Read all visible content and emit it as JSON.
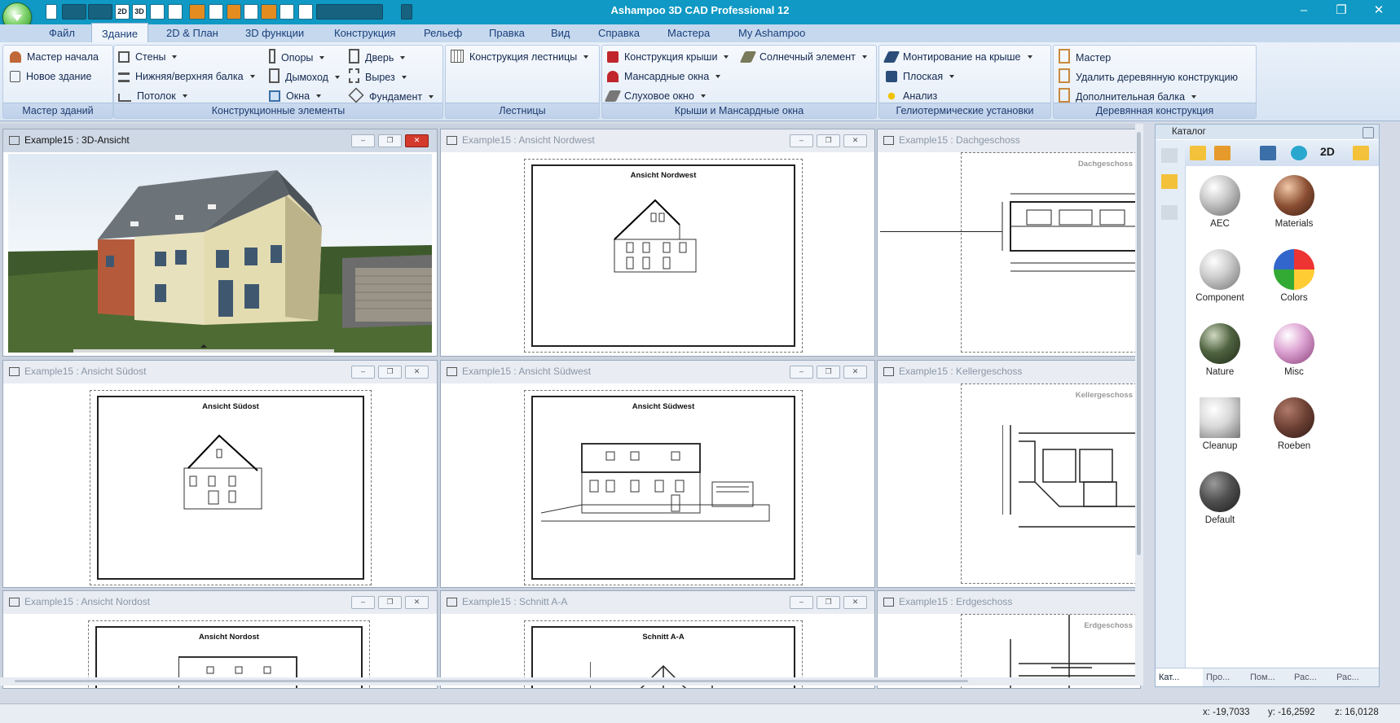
{
  "app": {
    "title": "Ashampoo 3D CAD Professional 12",
    "window_controls": [
      "minimize-icon",
      "maximize-icon",
      "close-icon"
    ],
    "quick_access": [
      "2D",
      "3D"
    ]
  },
  "ribbon": {
    "tabs": [
      "Файл",
      "Здание",
      "2D & План",
      "3D функции",
      "Конструкция",
      "Рельеф",
      "Правка",
      "Вид",
      "Справка",
      "Мастера",
      "My Ashampoo"
    ],
    "active_tab": "Здание",
    "groups": {
      "wizard": {
        "label": "Мастер зданий",
        "items": [
          "Мастер начала",
          "Новое здание"
        ]
      },
      "construction": {
        "label": "Конструкционные элементы",
        "items": [
          "Стены",
          "Нижняя/верхняя балка",
          "Потолок",
          "Опоры",
          "Дымоход",
          "Окна",
          "Дверь",
          "Вырез",
          "Фундамент"
        ]
      },
      "stairs": {
        "label": "Лестницы",
        "items": [
          "Конструкция лестницы"
        ]
      },
      "roofs": {
        "label": "Крыши и Мансардные окна",
        "items": [
          "Конструкция крыши",
          "Мансардные окна",
          "Слуховое окно",
          "Солнечный элемент"
        ]
      },
      "solar": {
        "label": "Гелиотермические установки",
        "items": [
          "Монтирование на крыше",
          "Плоская",
          "Анализ"
        ]
      },
      "timber": {
        "label": "Деревянная конструкция",
        "items": [
          "Мастер",
          "Удалить деревянную конструкцию",
          "Дополнительная балка"
        ]
      }
    }
  },
  "documents": [
    {
      "title": "Example15 : 3D-Ansicht",
      "active": true
    },
    {
      "title": "Example15 : Ansicht Nordwest",
      "sheet_title": "Ansicht Nordwest"
    },
    {
      "title": "Example15 : Dachgeschoss",
      "sheet_title": "Dachgeschoss"
    },
    {
      "title": "Example15 : Ansicht Südost",
      "sheet_title": "Ansicht Südost"
    },
    {
      "title": "Example15 : Ansicht Südwest",
      "sheet_title": "Ansicht Südwest"
    },
    {
      "title": "Example15 : Kellergeschoss",
      "sheet_title": "Kellergeschoss"
    },
    {
      "title": "Example15 : Ansicht Nordost",
      "sheet_title": "Ansicht Nordost"
    },
    {
      "title": "Example15 : Schnitt A-A",
      "sheet_title": "Schnitt A-A"
    },
    {
      "title": "Example15 : Erdgeschoss",
      "sheet_title": "Erdgeschoss"
    }
  ],
  "catalog": {
    "title": "Каталог",
    "items": [
      "AEC",
      "Materials",
      "Component",
      "Colors",
      "Nature",
      "Misc",
      "Cleanup",
      "Roeben",
      "Default"
    ],
    "toolbar_label": "2D",
    "bottom_tabs": [
      "Кат...",
      "Про...",
      "Пом...",
      "Рас...",
      "Рас..."
    ]
  },
  "status": {
    "x": "x: -19,7033",
    "y": "y: -16,2592",
    "z": "z: 16,0128"
  }
}
